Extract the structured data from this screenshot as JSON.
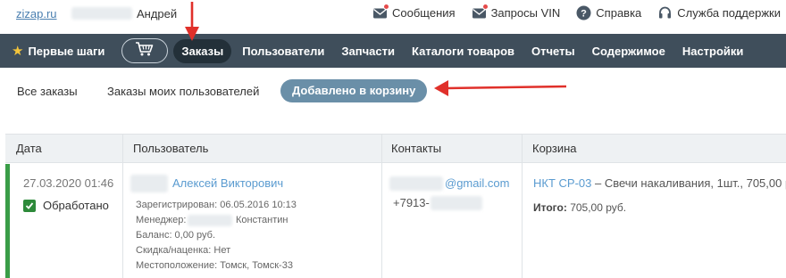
{
  "topbar": {
    "brand": "zizap.ru",
    "user_name": "Андрей",
    "links": [
      {
        "label": "Сообщения",
        "icon": "mail-icon",
        "badge": true
      },
      {
        "label": "Запросы VIN",
        "icon": "mail-icon",
        "badge": true
      },
      {
        "label": "Справка",
        "icon": "help-icon",
        "badge": false
      },
      {
        "label": "Служба поддержки",
        "icon": "headset-icon",
        "badge": false
      }
    ]
  },
  "nav": {
    "first_steps": "Первые шаги",
    "orders": "Заказы",
    "users": "Пользователи",
    "parts": "Запчасти",
    "catalogs": "Каталоги товаров",
    "reports": "Отчеты",
    "content": "Содержимое",
    "settings": "Настройки"
  },
  "subtabs": {
    "all": "Все заказы",
    "my_users": "Заказы моих пользователей",
    "added_to_cart": "Добавлено в корзину"
  },
  "table": {
    "headers": {
      "date": "Дата",
      "user": "Пользователь",
      "contacts": "Контакты",
      "cart": "Корзина"
    },
    "row": {
      "date": "27.03.2020 01:46",
      "status": "Обработано",
      "user_name": "Алексей Викторович",
      "registered": "Зарегистрирован: 06.05.2016 10:13",
      "manager": "Менеджер:",
      "manager_name": "Константин",
      "balance": "Баланс: 0,00 руб.",
      "discount": "Скидка/наценка: Нет",
      "location": "Местоположение: Томск, Томск-33",
      "email": "@gmail.com",
      "phone": "+7913-",
      "cart_item_link": "НКТ CP-03",
      "cart_item_desc": "– Свечи накаливания, 1шт., 705,00 р",
      "total_label": "Итого:",
      "total_value": "705,00 руб."
    }
  },
  "colors": {
    "nav_bg": "#3f4e5b",
    "active_tab": "#6a8fa8",
    "link": "#5a9bd0",
    "status_green": "#3a9d47",
    "annotation_arrow": "#e0302a"
  }
}
